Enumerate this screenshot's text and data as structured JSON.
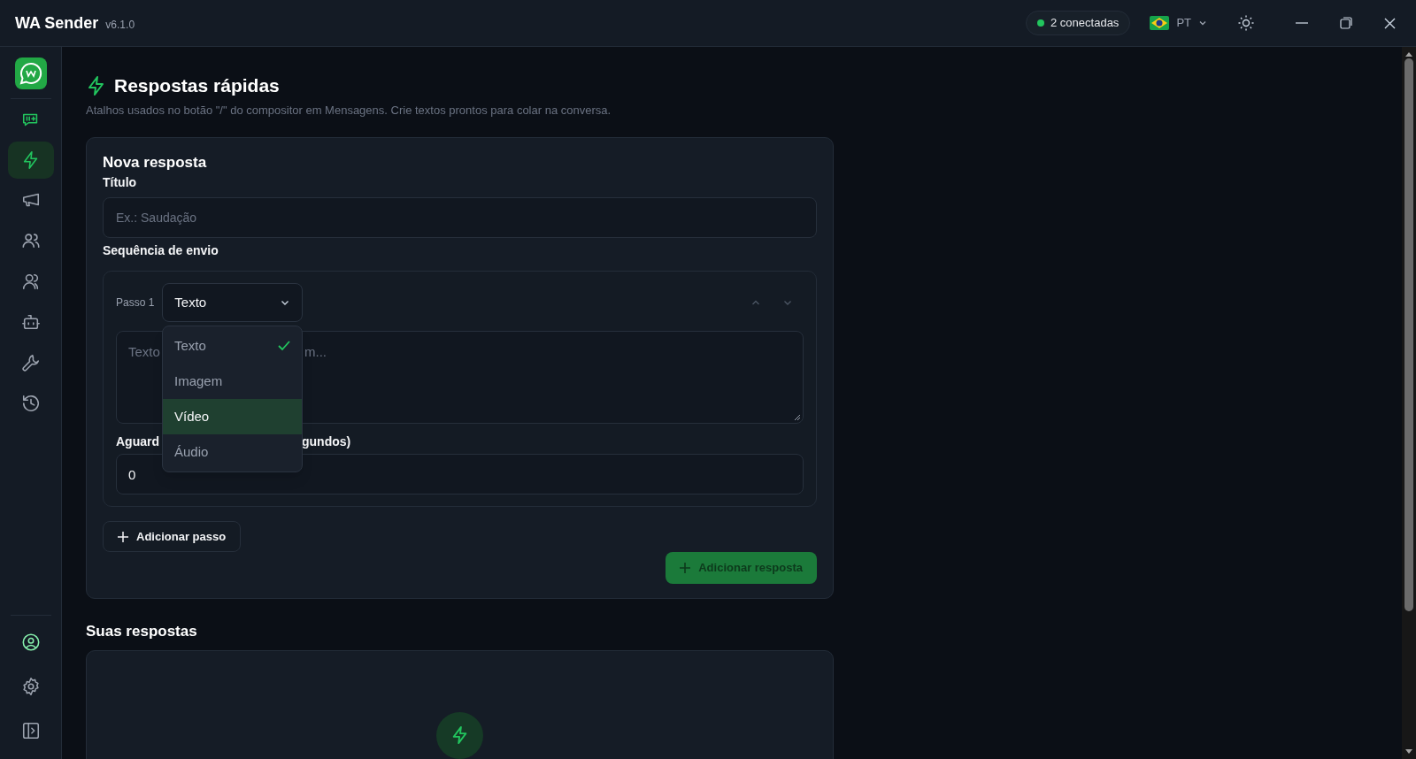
{
  "app": {
    "title": "WA Sender",
    "version": "v6.1.0"
  },
  "titlebar": {
    "status": {
      "label": "2 conectadas",
      "color": "#22c55e"
    },
    "language": "PT"
  },
  "sidebar": {
    "items": [
      {
        "kind": "chat",
        "selected": false
      },
      {
        "kind": "bolt",
        "selected": true
      },
      {
        "kind": "megaphone",
        "selected": false
      },
      {
        "kind": "users",
        "selected": false
      },
      {
        "kind": "users2",
        "selected": false
      },
      {
        "kind": "bot",
        "selected": false
      },
      {
        "kind": "wrench",
        "selected": false
      },
      {
        "kind": "history",
        "selected": false
      }
    ],
    "bottom": [
      {
        "kind": "account"
      },
      {
        "kind": "settings"
      },
      {
        "kind": "panel"
      }
    ]
  },
  "page": {
    "title": "Respostas rápidas",
    "subtitle": "Atalhos usados no botão \"/\" do compositor em Mensagens. Crie textos prontos para colar na conversa."
  },
  "form": {
    "heading": "Nova resposta",
    "title_label": "Título",
    "title_placeholder": "Ex.: Saudação",
    "sequence_label": "Sequência de envio",
    "step": {
      "label": "Passo 1",
      "type": "Texto",
      "text_placeholder_start": "Texto",
      "text_placeholder_end": "m...",
      "wait_label_start": "Aguard",
      "wait_label_end": "gundos)",
      "wait_value": "0"
    },
    "dropdown": [
      {
        "label": "Texto",
        "checked": true,
        "selected": false
      },
      {
        "label": "Imagem",
        "checked": false,
        "selected": false
      },
      {
        "label": "Vídeo",
        "checked": false,
        "selected": true
      },
      {
        "label": "Áudio",
        "checked": false,
        "selected": false
      }
    ],
    "add_step": "Adicionar passo",
    "submit": "Adicionar resposta"
  },
  "list": {
    "heading": "Suas respostas"
  }
}
